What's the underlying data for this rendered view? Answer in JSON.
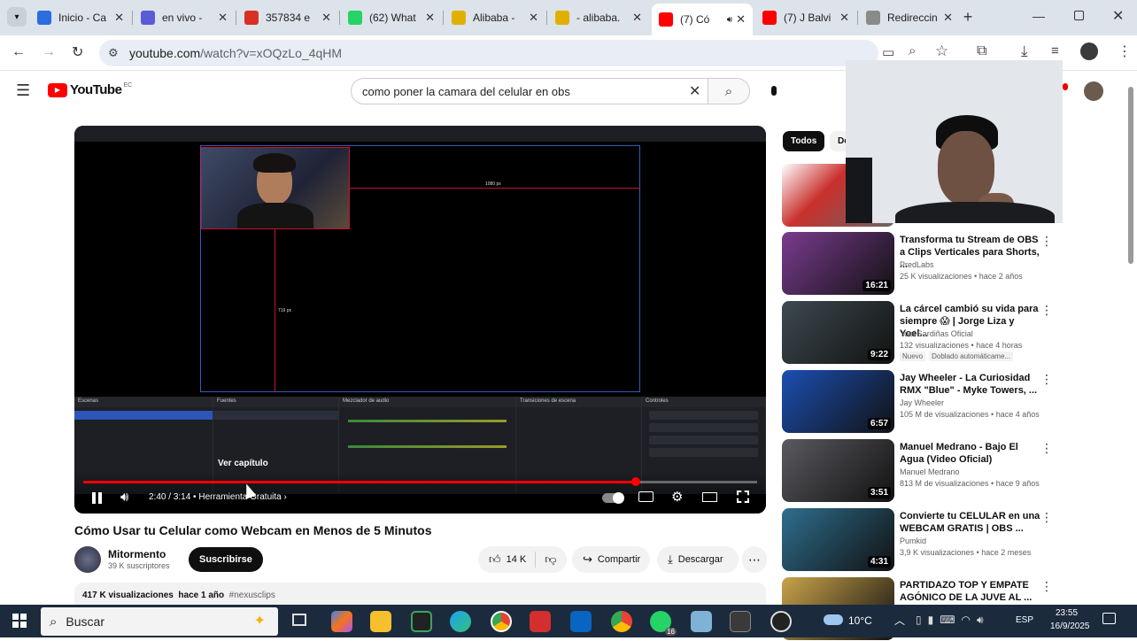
{
  "browser": {
    "tabs": [
      {
        "title": "Inicio - Ca",
        "color": "#2b6cde"
      },
      {
        "title": "en vivo - ",
        "color": "#5b5bd6"
      },
      {
        "title": "357834 e",
        "color": "#d93025"
      },
      {
        "title": "(62) What",
        "color": "#25d366"
      },
      {
        "title": "Alibaba - ",
        "color": "#e0b000"
      },
      {
        "title": "- alibaba.",
        "color": "#e0b000"
      },
      {
        "title": "(7) Có",
        "color": "#ff0000"
      },
      {
        "title": "(7) J Balvi",
        "color": "#ff0000"
      },
      {
        "title": "Redireccin",
        "color": "#8a8a8a"
      }
    ],
    "url_domain": "youtube.com",
    "url_path": "/watch?v=xOQzLo_4qHM"
  },
  "youtube": {
    "logo_text": "YouTube",
    "country": "EC",
    "search_query": "como poner la camara del celular en obs",
    "video": {
      "title": "Cómo Usar tu Celular como Webcam en Menos de 5 Minutos",
      "time_current": "2:40",
      "time_total": "3:14",
      "chapter": "Herramienta Gratuita",
      "chapter_overlay": "Ver capítulo",
      "progress": 0.82,
      "channel": "Mitormento",
      "subscribers": "39 K suscriptores",
      "subscribe_label": "Suscribirse",
      "likes": "14 K",
      "share_label": "Compartir",
      "download_label": "Descargar",
      "views": "417 K visualizaciones",
      "age": "hace 1 año",
      "hashtag": "#nexusclips",
      "obs_dims_w": "1080 px",
      "obs_dims_h": "719 px",
      "obs_panels": [
        "Escenas",
        "Fuentes",
        "Mezclador de audio",
        "Transiciones de escena",
        "Controles"
      ]
    },
    "chips": [
      "Todos",
      "De"
    ],
    "recommendations": [
      {
        "title": "Transforma tu Stream de OBS a Clips Verticales para Shorts, ...",
        "channel": "PredLabs",
        "meta": "25 K visualizaciones • hace 2 años",
        "duration": "16:21",
        "thumb": "#7a3b8f"
      },
      {
        "title": "La cárcel cambió su vida para siempre 😱 | Jorge Liza y Yoel...",
        "channel": "Yoel Sardiñas Oficial",
        "meta": "132 visualizaciones • hace 4 horas",
        "badge1": "Nuevo",
        "badge2": "Doblado automáticame...",
        "duration": "9:22",
        "thumb": "#3d4a4f"
      },
      {
        "title": "Jay Wheeler - La Curiosidad RMX \"Blue\" - Myke Towers, ...",
        "channel": "Jay Wheeler",
        "meta": "105 M de visualizaciones • hace 4 años",
        "duration": "6:57",
        "thumb": "#1b4fb3"
      },
      {
        "title": "Manuel Medrano - Bajo El Agua (Video Oficial)",
        "channel": "Manuel Medrano",
        "meta": "813 M de visualizaciones • hace 9 años",
        "duration": "3:51",
        "thumb": "#5a5a60"
      },
      {
        "title": "Convierte tu CELULAR en una WEBCAM GRATIS | OBS ...",
        "channel": "Pumkid",
        "meta": "3,9 K visualizaciones • hace 2 meses",
        "duration": "4:31",
        "thumb": "#2e6e8e"
      },
      {
        "title": "PARTIDAZO TOP Y EMPATE AGÓNICO DE LA JUVE AL ...",
        "channel": "",
        "meta": "",
        "duration": "",
        "thumb": "#c9a34a"
      }
    ]
  },
  "taskbar": {
    "search_placeholder": "Buscar",
    "weather": "10°C",
    "lang": "ESP",
    "time": "23:55",
    "date": "16/9/2025",
    "whatsapp_badge": "16"
  }
}
